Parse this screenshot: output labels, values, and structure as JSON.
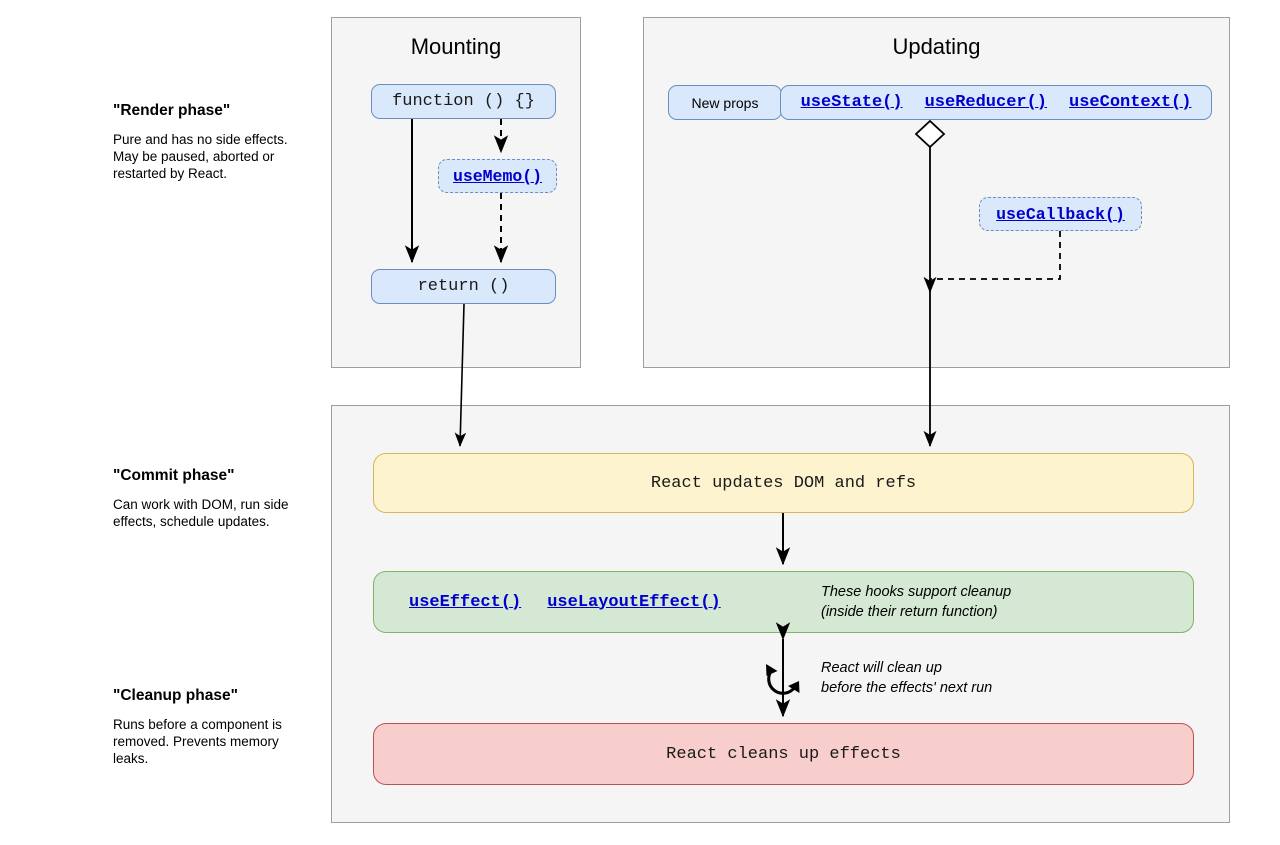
{
  "phases": [
    {
      "id": "render",
      "title": "\"Render phase\"",
      "description": "Pure and has no side effects. May be paused, aborted or restarted by React."
    },
    {
      "id": "commit",
      "title": "\"Commit phase\"",
      "description": "Can work with DOM, run side effects, schedule updates."
    },
    {
      "id": "cleanup",
      "title": "\"Cleanup phase\"",
      "description": "Runs before a component is removed. Prevents memory leaks."
    }
  ],
  "mounting": {
    "title": "Mounting",
    "function_node": "function () {}",
    "usememo_node": "useMemo()",
    "return_node": "return ()"
  },
  "updating": {
    "title": "Updating",
    "new_props": "New props",
    "hooks": [
      "useState()",
      "useReducer()",
      "useContext()"
    ],
    "usecallback_node": "useCallback()"
  },
  "commit": {
    "dom_node": "React updates DOM and refs",
    "effect_hooks": [
      "useEffect()",
      "useLayoutEffect()"
    ],
    "effect_note_line1": "These hooks support cleanup",
    "effect_note_line2": "(inside their return function)",
    "loop_note_line1": "React will clean up",
    "loop_note_line2": "before the effects' next run",
    "cleanup_node": "React cleans up effects"
  },
  "colors": {
    "blue_fill": "#dae8fc",
    "blue_stroke": "#6c8ebf",
    "yellow_fill": "#fdf4cf",
    "yellow_stroke": "#d6b656",
    "green_fill": "#d5e8d4",
    "green_stroke": "#82b366",
    "red_fill": "#f8cecc",
    "red_stroke": "#b85450",
    "panel_fill": "#f5f5f5",
    "panel_stroke": "#9e9e9e",
    "link_color": "#0000cc"
  }
}
